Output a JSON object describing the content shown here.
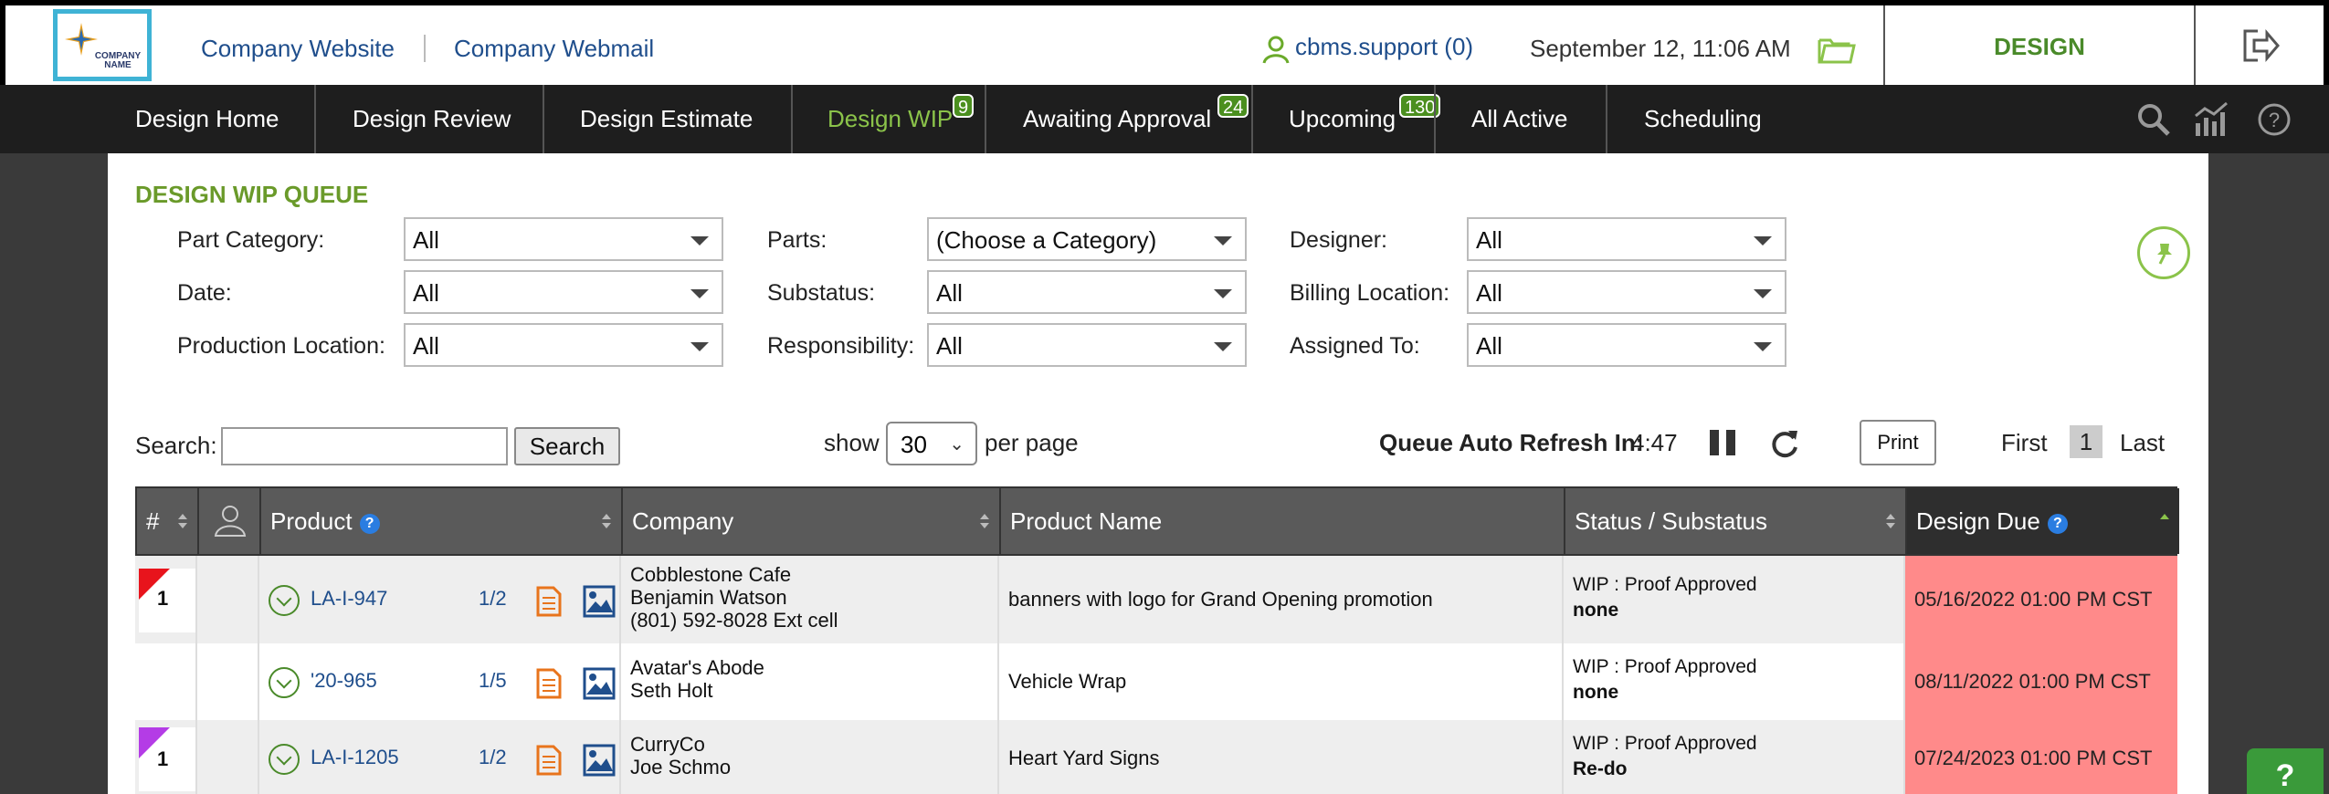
{
  "header": {
    "logo_text": "COMPANY NAME",
    "links": [
      "Company Website",
      "Company Webmail"
    ],
    "user": "cbms.support (0)",
    "datetime": "September 12, 11:06 AM",
    "mode": "DESIGN"
  },
  "nav": {
    "items": [
      {
        "label": "Design Home"
      },
      {
        "label": "Design Review"
      },
      {
        "label": "Design Estimate"
      },
      {
        "label": "Design WIP",
        "badge": "9",
        "active": true
      },
      {
        "label": "Awaiting Approval",
        "badge": "24"
      },
      {
        "label": "Upcoming",
        "badge": "130"
      },
      {
        "label": "All Active"
      },
      {
        "label": "Scheduling"
      }
    ]
  },
  "queue": {
    "title": "DESIGN WIP QUEUE",
    "filters": [
      {
        "label": "Part Category:",
        "value": "All"
      },
      {
        "label": "Parts:",
        "value": "(Choose a Category)"
      },
      {
        "label": "Designer:",
        "value": "All"
      },
      {
        "label": "Date:",
        "value": "All"
      },
      {
        "label": "Substatus:",
        "value": "All"
      },
      {
        "label": "Billing Location:",
        "value": "All"
      },
      {
        "label": "Production Location:",
        "value": "All"
      },
      {
        "label": "Responsibility:",
        "value": "All"
      },
      {
        "label": "Assigned To:",
        "value": "All"
      }
    ],
    "search_label": "Search:",
    "search_value": "",
    "search_button": "Search",
    "show_label": "show",
    "per_page": "30",
    "per_page_label": "per page",
    "refresh_label": "Queue Auto Refresh In:",
    "refresh_value": "4:47",
    "print_label": "Print",
    "pager": {
      "first": "First",
      "current": "1",
      "last": "Last"
    }
  },
  "table": {
    "headers": [
      "#",
      "",
      "Product",
      "Company",
      "Product Name",
      "Status / Substatus",
      "Design Due"
    ],
    "rows": [
      {
        "num": "1",
        "flag_color": "#e8141c",
        "product": "LA-I-947",
        "fraction": "1/2",
        "company": [
          "Cobblestone Cafe",
          "Benjamin Watson",
          "(801) 592-8028 Ext cell"
        ],
        "product_name": "banners with logo for Grand Opening promotion",
        "status": "WIP : Proof Approved",
        "substatus": "none",
        "due": "05/16/2022 01:00 PM CST"
      },
      {
        "num": "",
        "flag_color": "",
        "product": "'20-965",
        "fraction": "1/5",
        "company": [
          "Avatar's Abode",
          "Seth Holt"
        ],
        "product_name": "Vehicle Wrap",
        "status": "WIP : Proof Approved",
        "substatus": "none",
        "due": "08/11/2022 01:00 PM CST"
      },
      {
        "num": "1",
        "flag_color": "#b43ce6",
        "product": "LA-I-1205",
        "fraction": "1/2",
        "company": [
          "CurryCo",
          "Joe Schmo"
        ],
        "product_name": "Heart Yard Signs",
        "status": "WIP : Proof Approved",
        "substatus": "Re-do",
        "due": "07/24/2023 01:00 PM CST"
      }
    ]
  },
  "help_fab": "?",
  "colors": {
    "accent_green": "#6a9a2a",
    "due_red": "#ff8a8a",
    "nav_bg": "#1e1e1e",
    "link_blue": "#1f4e8c"
  }
}
